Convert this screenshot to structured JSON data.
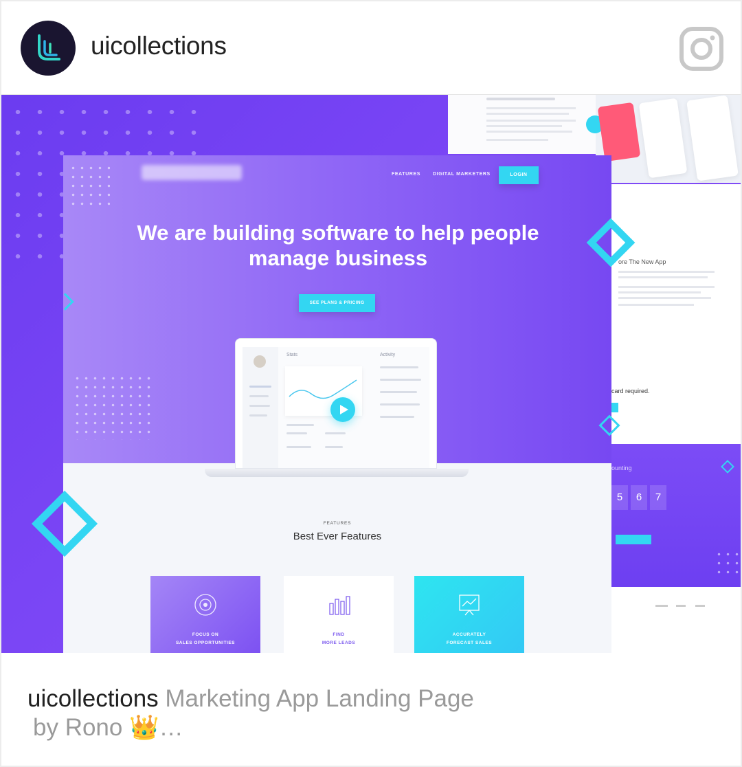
{
  "post": {
    "username": "uicollections",
    "platform_icon": "instagram-icon"
  },
  "mockup": {
    "nav": {
      "features": "FEATURES",
      "digital_marketers": "DIGITAL MARKETERS",
      "login": "LOGIN"
    },
    "hero_title": "We are building software to help people manage business",
    "cta": "SEE PLANS & PRICING",
    "dashboard": {
      "stats_label": "Stats",
      "activity_label": "Activity"
    },
    "features_label": "FEATURES",
    "features_title": "Best Ever  Features",
    "feature_cards": [
      {
        "line1": "FOCUS ON",
        "line2": "SALES OPPORTUNITIES",
        "icon": "target-icon"
      },
      {
        "line1": "FIND",
        "line2": "MORE LEADS",
        "icon": "bar-chart-icon"
      },
      {
        "line1": "ACCURATELY",
        "line2": "FORECAST SALES",
        "icon": "presentation-icon"
      }
    ],
    "background_page": {
      "heading": "ore The New App",
      "card_required": "card required.",
      "counting": "ounting",
      "digits": [
        "5",
        "6",
        "7"
      ]
    },
    "colors": {
      "accent": "#33d6f2",
      "purple": "#7748f2",
      "light_purple": "#a888f7"
    }
  },
  "caption": {
    "username": "uicollections",
    "text": "Marketing App Landing Page",
    "line2": "by Rono 👑…"
  }
}
